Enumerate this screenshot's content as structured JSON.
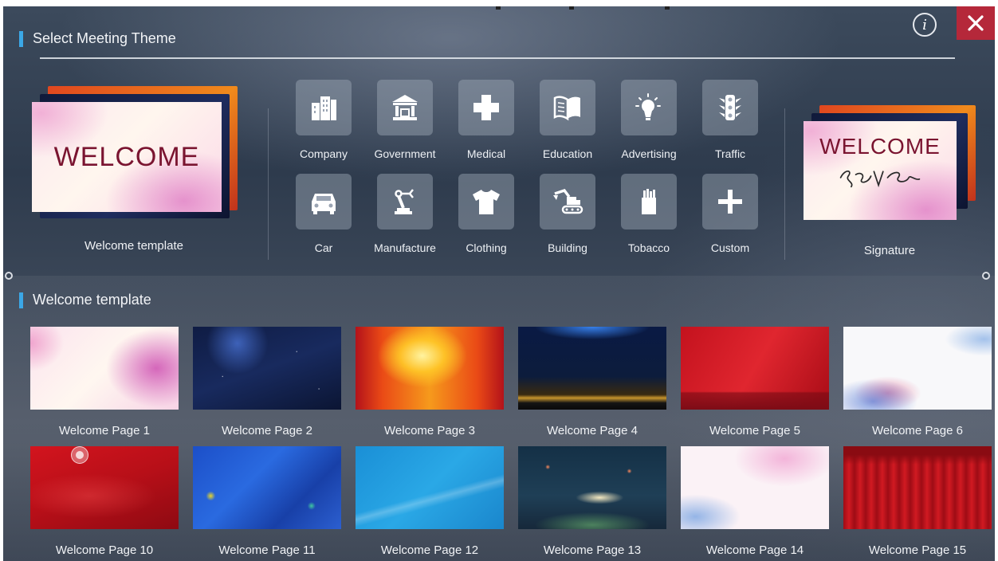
{
  "header": {
    "title": "Select Meeting Theme"
  },
  "controls": {
    "info_glyph": "i"
  },
  "preview": {
    "card_text": "WELCOME",
    "caption": "Welcome template"
  },
  "categories": [
    {
      "label": "Company",
      "icon": "building-icon"
    },
    {
      "label": "Government",
      "icon": "government-icon"
    },
    {
      "label": "Medical",
      "icon": "medical-cross-icon"
    },
    {
      "label": "Education",
      "icon": "book-icon"
    },
    {
      "label": "Advertising",
      "icon": "lightbulb-icon"
    },
    {
      "label": "Traffic",
      "icon": "traffic-light-icon"
    },
    {
      "label": "Car",
      "icon": "car-icon"
    },
    {
      "label": "Manufacture",
      "icon": "robot-arm-icon"
    },
    {
      "label": "Clothing",
      "icon": "tshirt-icon"
    },
    {
      "label": "Building",
      "icon": "excavator-icon"
    },
    {
      "label": "Tobacco",
      "icon": "cigarette-pack-icon"
    },
    {
      "label": "Custom",
      "icon": "plus-icon"
    }
  ],
  "signature": {
    "card_text": "WELCOME",
    "caption": "Signature"
  },
  "gallery": {
    "title": "Welcome template",
    "items": [
      {
        "label": "Welcome Page 1"
      },
      {
        "label": "Welcome Page 2"
      },
      {
        "label": "Welcome Page 3"
      },
      {
        "label": "Welcome Page 4"
      },
      {
        "label": "Welcome Page 5"
      },
      {
        "label": "Welcome Page 6"
      },
      {
        "label": "Welcome Page 10"
      },
      {
        "label": "Welcome Page 11"
      },
      {
        "label": "Welcome Page 12"
      },
      {
        "label": "Welcome Page 13"
      },
      {
        "label": "Welcome Page 14"
      },
      {
        "label": "Welcome Page 15"
      }
    ]
  },
  "colors": {
    "accent": "#3ba7e6",
    "close": "#b5283a",
    "welcome_text": "#7a1430"
  }
}
